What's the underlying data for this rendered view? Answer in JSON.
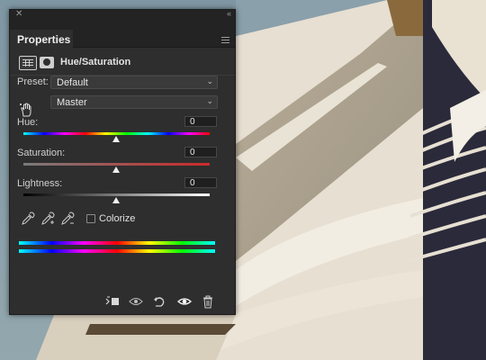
{
  "panel": {
    "tab_label": "Properties",
    "adjustment_title": "Hue/Saturation",
    "icons": [
      "close-icon",
      "collapse-icon",
      "menu-icon",
      "adjustment-layer-icon",
      "layer-mask-icon"
    ]
  },
  "preset": {
    "label": "Preset:",
    "value": "Default"
  },
  "channel": {
    "value": "Master",
    "icon": "target-adjust-hand-icon"
  },
  "hue": {
    "label": "Hue:",
    "value": "0",
    "slider_position": 0.5
  },
  "saturation": {
    "label": "Saturation:",
    "value": "0",
    "slider_position": 0.5
  },
  "lightness": {
    "label": "Lightness:",
    "value": "0",
    "slider_position": 0.5
  },
  "tools": {
    "droppers": [
      "eyedropper-icon",
      "eyedropper-plus-icon",
      "eyedropper-minus-icon"
    ],
    "colorize_label": "Colorize",
    "colorize_checked": false
  },
  "footer_icons": [
    "clip-to-layer-icon",
    "view-previous-state-icon",
    "reset-icon",
    "visibility-icon",
    "delete-icon"
  ],
  "colors": {
    "panel_bg": "#2e2e2e",
    "saturation_bar": "#cc2a2a",
    "accent_thumb": "#f0f0f0"
  }
}
